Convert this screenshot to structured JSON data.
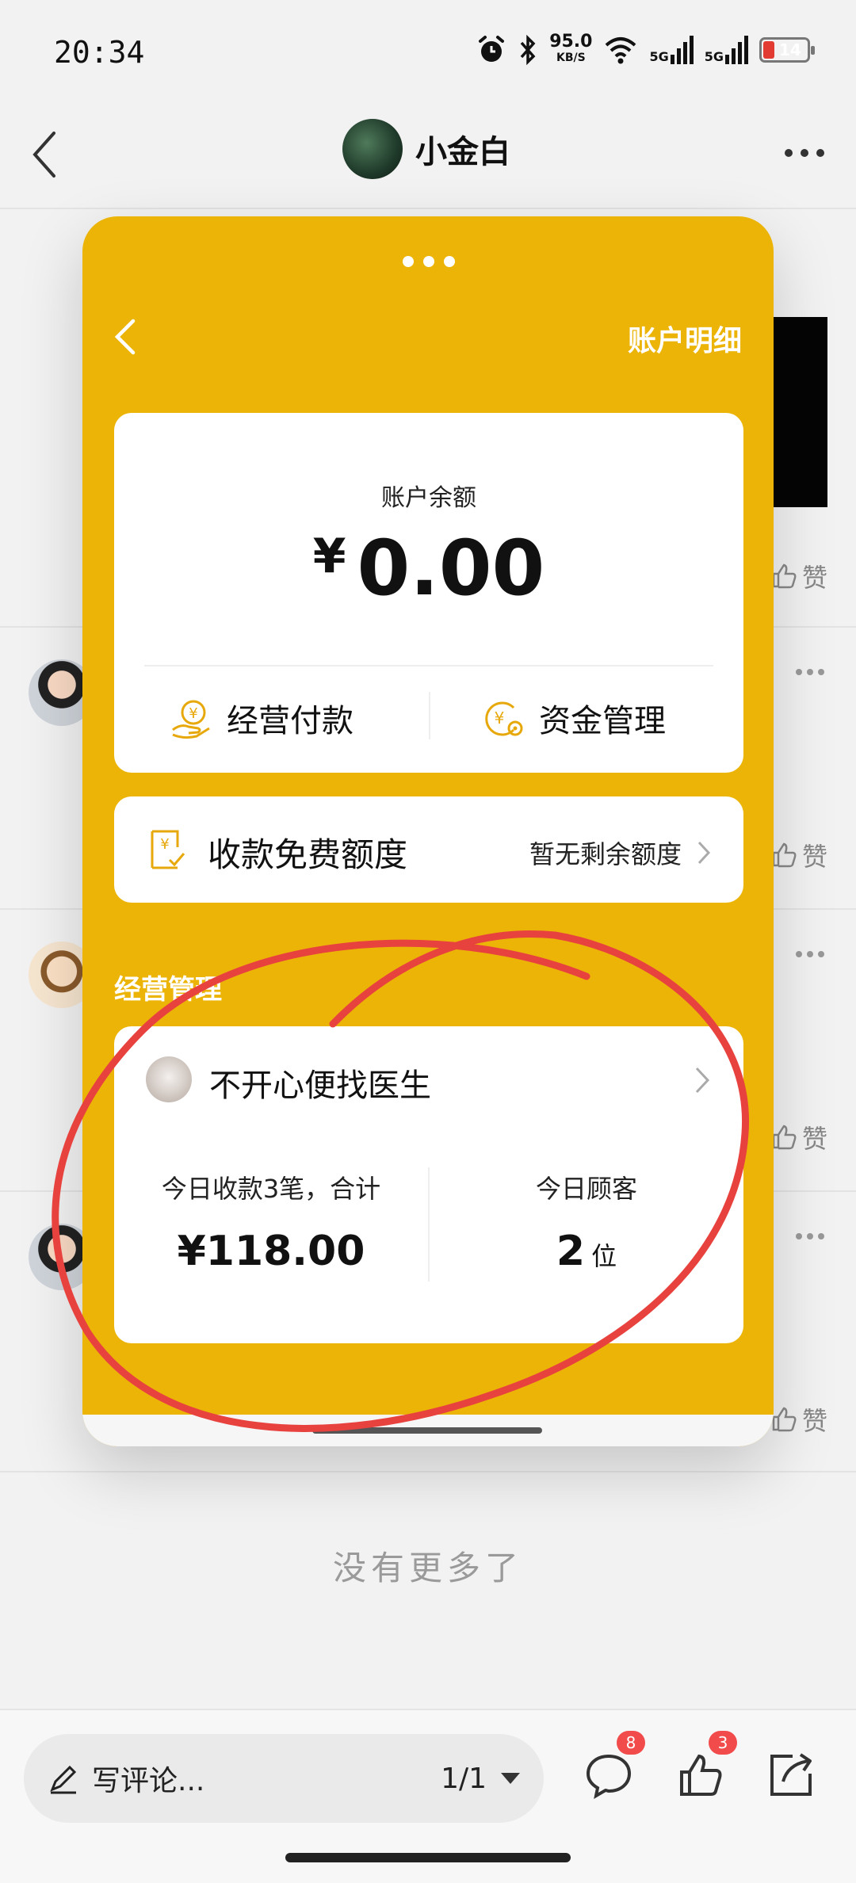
{
  "status_bar": {
    "time": "20:34",
    "speed_value": "95.0",
    "speed_unit": "KB/S",
    "network_1": "5G",
    "network_2": "5G",
    "battery": "14",
    "battery_level_percent": 14,
    "icons": [
      "alarm-icon",
      "bluetooth-icon",
      "wifi-icon",
      "signal-icon",
      "battery-icon"
    ]
  },
  "header": {
    "back_icon": "back-arrow-icon",
    "user_name": "小金白",
    "more_icon": "more-icon"
  },
  "feed": {
    "like_label": "赞",
    "no_more_text": "没有更多了"
  },
  "popup": {
    "title_right": "账户明细",
    "balance": {
      "label": "账户余额",
      "currency": "¥",
      "amount": "0.00"
    },
    "actions": [
      {
        "label": "经营付款",
        "icon": "yen-hand-icon"
      },
      {
        "label": "资金管理",
        "icon": "yen-gear-icon"
      }
    ],
    "quota": {
      "title": "收款免费额度",
      "status": "暂无剩余额度"
    },
    "section_label": "经营管理",
    "business": {
      "name": "不开心便找医生",
      "today_income_label": "今日收款3笔，合计",
      "today_income_value": "¥118.00",
      "today_customers_label": "今日顾客",
      "today_customers_value": "2",
      "today_customers_unit": "位"
    }
  },
  "bottom_bar": {
    "comment_placeholder": "写评论...",
    "page_indicator": "1/1",
    "comment_badge": "8",
    "like_badge": "3"
  },
  "colors": {
    "popup_yellow": "#ecb407",
    "badge_red": "#f24b4b",
    "annotation_red": "#e8423f"
  }
}
